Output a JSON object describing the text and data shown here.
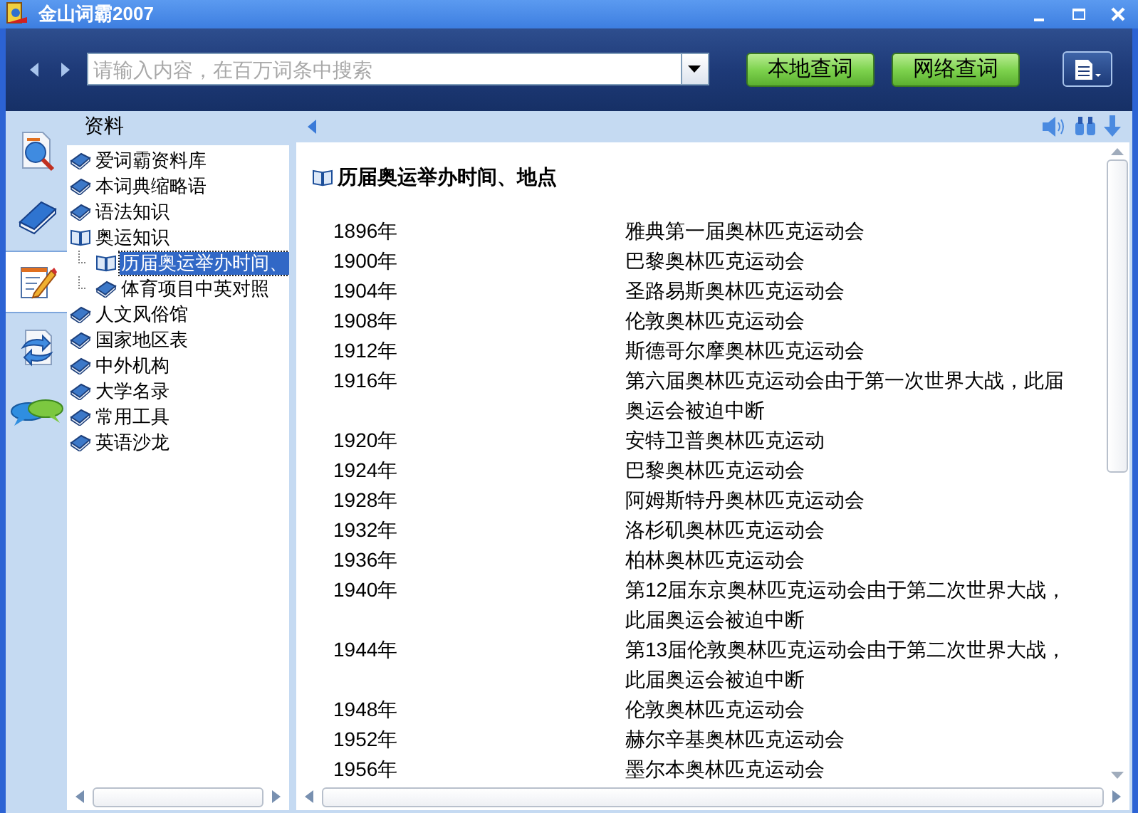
{
  "window": {
    "title": "金山词霸2007"
  },
  "toolbar": {
    "search": {
      "placeholder": "请输入内容，在百万词条中搜索"
    },
    "buttons": [
      "本地查词",
      "网络查词"
    ]
  },
  "rail": [
    {
      "kind": "search",
      "selected": false
    },
    {
      "kind": "book",
      "selected": false
    },
    {
      "kind": "notes",
      "selected": true
    },
    {
      "kind": "swap",
      "selected": false
    },
    {
      "kind": "chat",
      "selected": false
    }
  ],
  "tree": {
    "title": "资料",
    "items": [
      {
        "label": "爱词霸资料库",
        "expanded": false,
        "selected": false
      },
      {
        "label": "本词典缩略语",
        "expanded": false,
        "selected": false
      },
      {
        "label": "语法知识",
        "expanded": false,
        "selected": false
      },
      {
        "label": "奥运知识",
        "expanded": true,
        "selected": false,
        "children": [
          {
            "label": "历届奥运举办时间、",
            "expanded": true,
            "selected": true
          },
          {
            "label": "体育项目中英对照",
            "expanded": false,
            "selected": false
          }
        ]
      },
      {
        "label": "人文风俗馆",
        "expanded": false,
        "selected": false
      },
      {
        "label": "国家地区表",
        "expanded": false,
        "selected": false
      },
      {
        "label": "中外机构",
        "expanded": false,
        "selected": false
      },
      {
        "label": "大学名录",
        "expanded": false,
        "selected": false
      },
      {
        "label": "常用工具",
        "expanded": false,
        "selected": false
      },
      {
        "label": "英语沙龙",
        "expanded": false,
        "selected": false
      }
    ]
  },
  "content": {
    "title": "历届奥运举办时间、地点",
    "rows": [
      {
        "year": "1896年",
        "event": "雅典第一届奥林匹克运动会"
      },
      {
        "year": "1900年",
        "event": "巴黎奥林匹克运动会"
      },
      {
        "year": "1904年",
        "event": "圣路易斯奥林匹克运动会"
      },
      {
        "year": "1908年",
        "event": "伦敦奥林匹克运动会"
      },
      {
        "year": "1912年",
        "event": "斯德哥尔摩奥林匹克运动会"
      },
      {
        "year": "1916年",
        "event": "第六届奥林匹克运动会由于第一次世界大战，此届奥运会被迫中断"
      },
      {
        "year": "1920年",
        "event": "安特卫普奥林匹克运动"
      },
      {
        "year": "1924年",
        "event": "巴黎奥林匹克运动会"
      },
      {
        "year": "1928年",
        "event": "阿姆斯特丹奥林匹克运动会"
      },
      {
        "year": "1932年",
        "event": "洛杉矶奥林匹克运动会"
      },
      {
        "year": "1936年",
        "event": "柏林奥林匹克运动会"
      },
      {
        "year": "1940年",
        "event": "第12届东京奥林匹克运动会由于第二次世界大战，此届奥运会被迫中断"
      },
      {
        "year": "1944年",
        "event": "第13届伦敦奥林匹克运动会由于第二次世界大战，此届奥运会被迫中断"
      },
      {
        "year": "1948年",
        "event": "伦敦奥林匹克运动会"
      },
      {
        "year": "1952年",
        "event": "赫尔辛基奥林匹克运动会"
      },
      {
        "year": "1956年",
        "event": "墨尔本奥林匹克运动会"
      }
    ]
  }
}
